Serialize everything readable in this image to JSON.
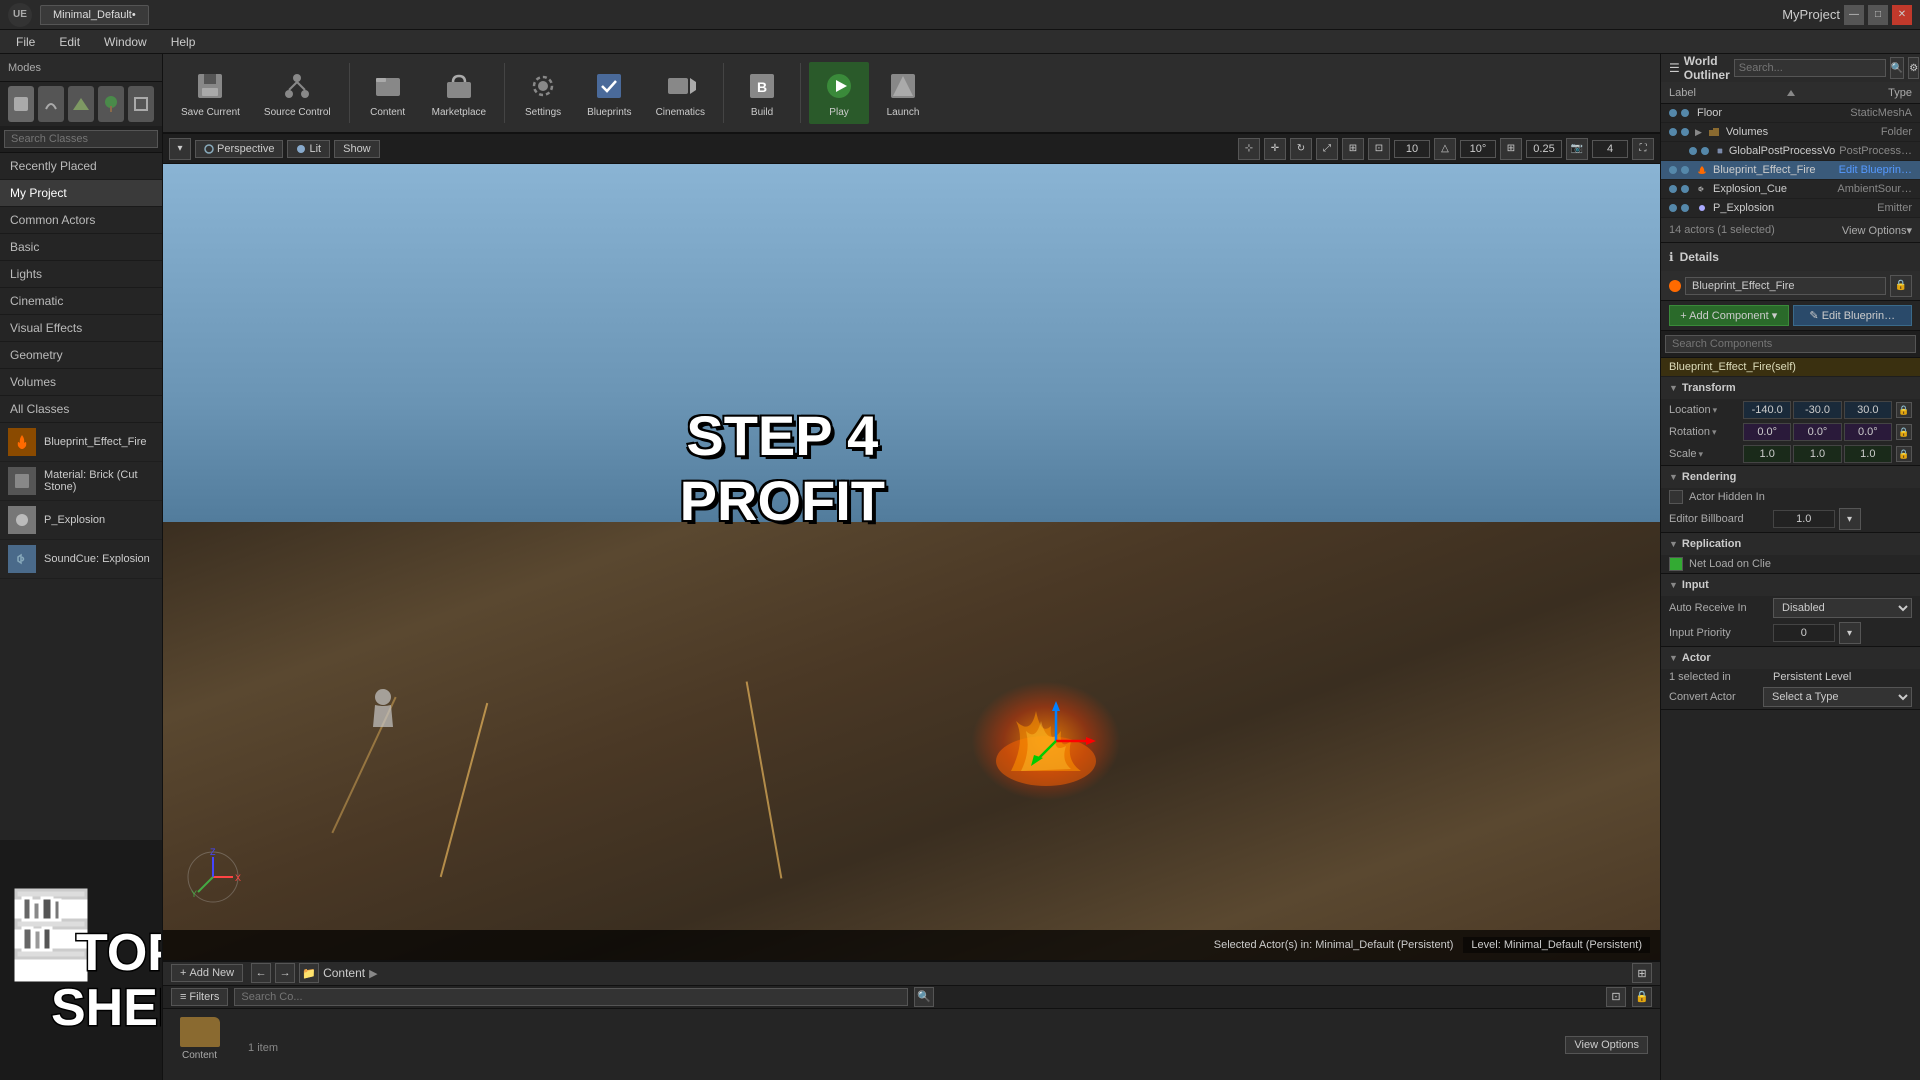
{
  "titleBar": {
    "projectTab": "Minimal_Default•",
    "projectName": "MyProject",
    "winBtns": [
      "—",
      "□",
      "✕"
    ]
  },
  "menuBar": {
    "items": [
      "File",
      "Edit",
      "Window",
      "Help"
    ]
  },
  "modesBar": {
    "label": "Modes"
  },
  "toolbar": {
    "buttons": [
      {
        "label": "Save Current",
        "icon": "💾"
      },
      {
        "label": "Source Control",
        "icon": "↕"
      },
      {
        "label": "Content",
        "icon": "📁"
      },
      {
        "label": "Marketplace",
        "icon": "🛒"
      },
      {
        "label": "Settings",
        "icon": "⚙"
      },
      {
        "label": "Blueprints",
        "icon": "📐"
      },
      {
        "label": "Cinematics",
        "icon": "🎬"
      },
      {
        "label": "Build",
        "icon": "🔨"
      },
      {
        "label": "Play",
        "icon": "▶"
      },
      {
        "label": "Launch",
        "icon": "🚀"
      }
    ]
  },
  "leftPanel": {
    "searchPlaceholder": "Search Classes",
    "navItems": [
      {
        "label": "Recently Placed",
        "active": false
      },
      {
        "label": "My Project",
        "active": true
      },
      {
        "label": "Common Actors",
        "active": false
      },
      {
        "label": "Basic",
        "active": false
      },
      {
        "label": "Lights",
        "active": false
      },
      {
        "label": "Cinematic",
        "active": false
      },
      {
        "label": "Visual Effects",
        "active": false
      },
      {
        "label": "Geometry",
        "active": false
      },
      {
        "label": "Volumes",
        "active": false
      },
      {
        "label": "All Classes",
        "active": false
      }
    ],
    "placedItems": [
      {
        "label": "Blueprint_Effect_Fire",
        "iconColor": "#8a4a00"
      },
      {
        "label": "Material: Brick (Cut Stone)",
        "iconColor": "#666"
      },
      {
        "label": "P_Explosion",
        "iconColor": "#aaa"
      },
      {
        "label": "SoundCue: Explosion",
        "iconColor": "#4a6a8a"
      }
    ]
  },
  "viewport": {
    "perspective": "Perspective",
    "litMode": "Lit",
    "showLabel": "Show",
    "numbers": [
      "10",
      "10°",
      "0.25"
    ],
    "overlayNumbers": [
      "10",
      "4"
    ],
    "step4": "STEP 4",
    "profit": "PROFIT",
    "statusActor": "Selected Actor(s) in:  Minimal_Default (Persistent)",
    "statusLevel": "Level:  Minimal_Default (Persistent)"
  },
  "contentBrowser": {
    "addLabel": "Add New",
    "filtersLabel": "Filters",
    "searchPlaceholder": "Search Co...",
    "path": "Content",
    "itemCount": "1 item",
    "viewOptionsLabel": "View Options"
  },
  "worldOutliner": {
    "title": "World Outliner",
    "searchPlaceholder": "Search...",
    "columns": [
      {
        "label": "Label"
      },
      {
        "label": "Type"
      }
    ],
    "items": [
      {
        "label": "Floor",
        "type": "StaticMeshA",
        "indent": 0,
        "vis": true,
        "color": "#5588aa"
      },
      {
        "label": "Volumes",
        "type": "Folder",
        "indent": 0,
        "vis": true,
        "color": "#5588aa",
        "folder": true
      },
      {
        "label": "GlobalPostProcessVo",
        "type": "PostProcess…",
        "indent": 1,
        "vis": true,
        "color": "#5588aa"
      },
      {
        "label": "Blueprint_Effect_Fire",
        "type": "Edit Blueprin…",
        "indent": 0,
        "vis": true,
        "color": "#5588aa",
        "selected": true
      },
      {
        "label": "Explosion_Cue",
        "type": "AmbientSour…",
        "indent": 0,
        "vis": true,
        "color": "#5588aa"
      },
      {
        "label": "P_Explosion",
        "type": "Emitter",
        "indent": 0,
        "vis": true,
        "color": "#5588aa"
      }
    ],
    "footer": {
      "count": "14 actors (1 selected)",
      "viewOptions": "View Options▾"
    }
  },
  "details": {
    "title": "Details",
    "actorName": "Blueprint_Effect_Fire",
    "addComponentLabel": "+ Add Component ▾",
    "editBlueprintLabel": "✎ Edit Blueprin…",
    "searchPlaceholder": "Search Components",
    "component": "Blueprint_Effect_Fire(self)",
    "transform": {
      "label": "Transform",
      "location": {
        "label": "Location",
        "x": "-140.0",
        "y": "-30.0",
        "z": "30.0"
      },
      "rotation": {
        "label": "Rotation",
        "x": "0.0°",
        "y": "0.0°",
        "z": "0.0°"
      },
      "scale": {
        "label": "Scale",
        "x": "1.0",
        "y": "1.0",
        "z": "1.0"
      }
    },
    "rendering": {
      "label": "Rendering",
      "hiddenInGame": "Actor Hidden In",
      "editorBillboard": "Editor Billboard",
      "billboardVal": "1.0"
    },
    "replication": {
      "label": "Replication",
      "netLoad": "Net Load on Clie"
    },
    "input": {
      "label": "Input",
      "autoReceive": "Auto Receive In",
      "autoVal": "Disabled",
      "priority": "Input Priority",
      "priorityVal": "0"
    },
    "actor": {
      "label": "Actor",
      "selectedIn": "1 selected in",
      "selectedInVal": "Persistent Level",
      "convertActor": "Convert Actor",
      "selectType": "Select a Type"
    }
  }
}
